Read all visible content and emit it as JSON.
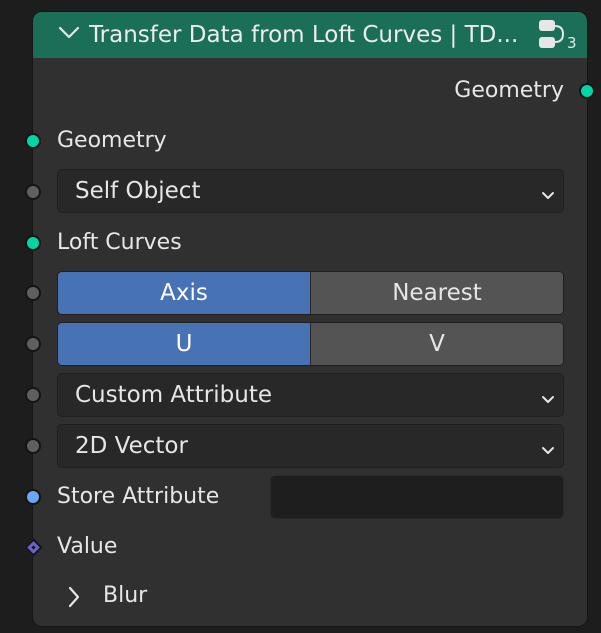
{
  "node": {
    "title": "Transfer Data from Loft Curves | TD...",
    "group_user_count": "3",
    "header_color": "#1b6f59"
  },
  "outputs": {
    "geometry_label": "Geometry"
  },
  "inputs": {
    "geometry_label": "Geometry",
    "self_object": {
      "value": "Self Object"
    },
    "loft_curves_label": "Loft Curves",
    "mode_toggle": {
      "options": [
        "Axis",
        "Nearest"
      ],
      "selected": "Axis"
    },
    "uv_toggle": {
      "options": [
        "U",
        "V"
      ],
      "selected": "U"
    },
    "attribute_source": {
      "value": "Custom Attribute"
    },
    "data_type": {
      "value": "2D Vector"
    },
    "store_attribute": {
      "label": "Store Attribute",
      "value": ""
    },
    "value_label": "Value",
    "blur_panel": {
      "label": "Blur",
      "expanded": false
    }
  },
  "colors": {
    "geometry_socket": "#00d6a3",
    "gray_socket": "#5f5f5f",
    "string_socket": "#6aa9f2",
    "vector_socket": "#6b62c8",
    "active_button": "#4772b3"
  },
  "icons": {
    "collapse": "chevron-down-icon",
    "group": "node-group-icon",
    "dropdown": "chevron-down-icon",
    "panel": "chevron-right-icon"
  }
}
